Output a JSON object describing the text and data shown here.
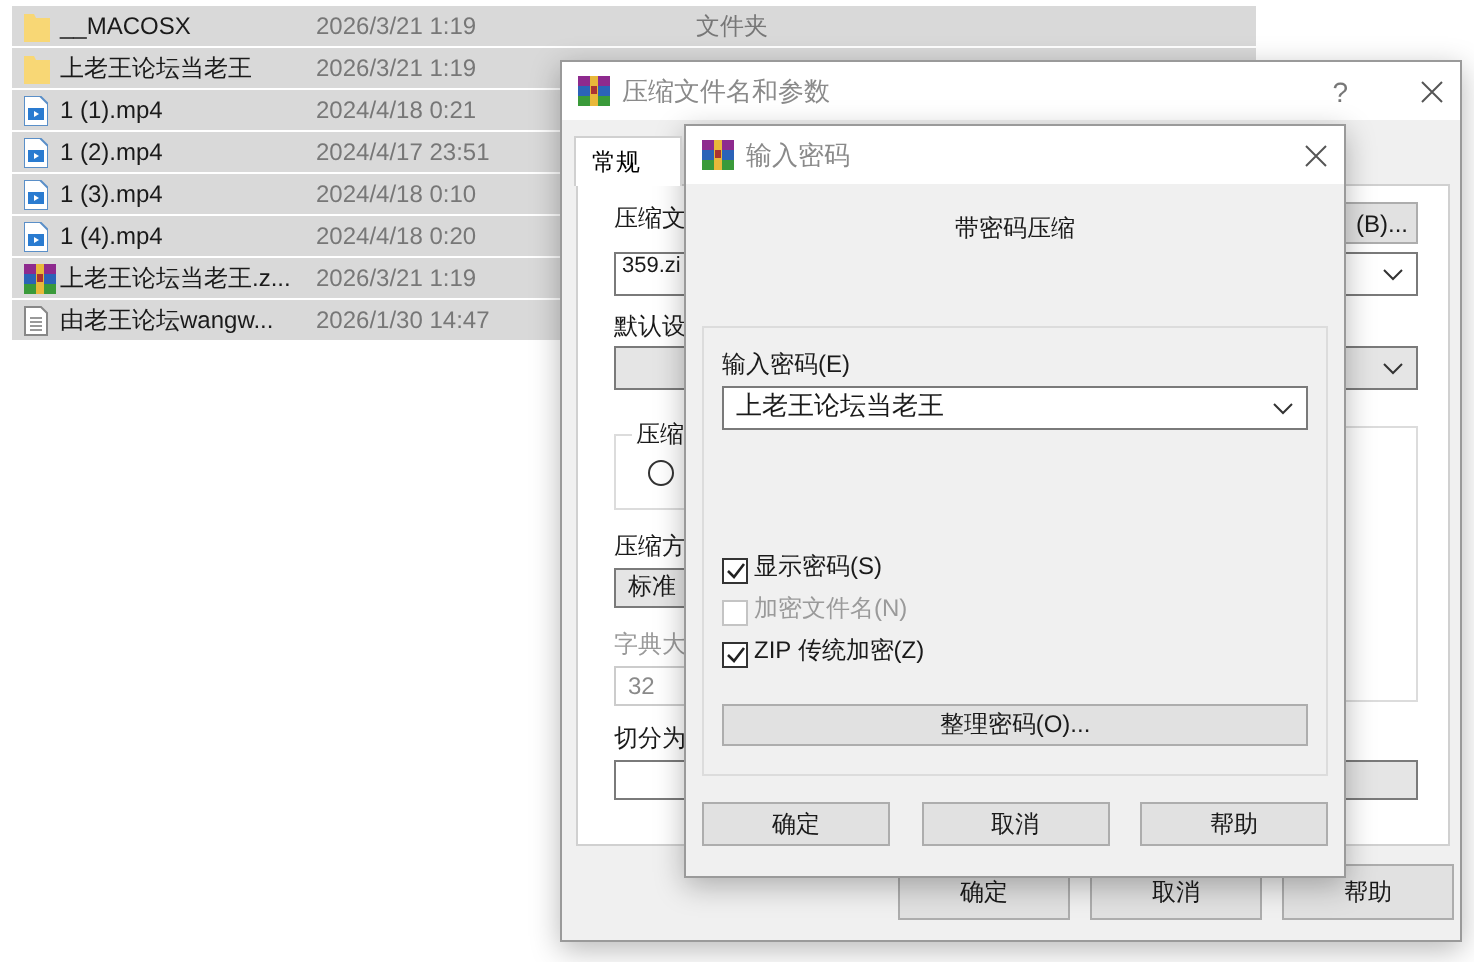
{
  "file_list": {
    "rows": [
      {
        "kind": "folder",
        "name": "__MACOSX",
        "date": "2026/3/21 1:19",
        "type": "文件夹",
        "selected": true
      },
      {
        "kind": "folder",
        "name": "上老王论坛当老王",
        "date": "2026/3/21 1:19",
        "selected": true
      },
      {
        "kind": "video",
        "name": "1 (1).mp4",
        "date": "2024/4/18 0:21",
        "selected": true
      },
      {
        "kind": "video",
        "name": "1 (2).mp4",
        "date": "2024/4/17 23:51",
        "selected": true
      },
      {
        "kind": "video",
        "name": "1 (3).mp4",
        "date": "2024/4/18 0:10",
        "selected": true
      },
      {
        "kind": "video",
        "name": "1 (4).mp4",
        "date": "2024/4/18 0:20",
        "selected": true
      },
      {
        "kind": "archive",
        "name": "上老王论坛当老王.z...",
        "date": "2026/3/21 1:19",
        "selected": true
      },
      {
        "kind": "text",
        "name": "由老王论坛wangw...",
        "date": "2026/1/30 14:47",
        "selected": true
      }
    ]
  },
  "archive_dialog": {
    "title": "压缩文件名和参数",
    "help": "?",
    "tabs": [
      {
        "label": "常规",
        "selected": true
      }
    ],
    "filename_label": "压缩文",
    "browse_button": "(B)...",
    "filename_value": "359.zi",
    "profile_label": "默认设",
    "format_group_label": "压缩",
    "format_option": {
      "selected": false
    },
    "method_label": "压缩方",
    "method_value": "标准",
    "dictionary_label": "字典大",
    "dictionary_value": "32",
    "split_label": "切分为",
    "buttons": [
      "确定",
      "取消",
      "帮助"
    ]
  },
  "password_dialog": {
    "title": "输入密码",
    "heading": "带密码压缩",
    "password_label": "输入密码(E)",
    "password_value": "上老王论坛当老王",
    "options": [
      {
        "label": "显示密码(S)",
        "checked": true,
        "disabled": false
      },
      {
        "label": "加密文件名(N)",
        "checked": false,
        "disabled": true
      },
      {
        "label": "ZIP 传统加密(Z)",
        "checked": true,
        "disabled": false
      }
    ],
    "organize_button": "整理密码(O)...",
    "buttons": [
      "确定",
      "取消",
      "帮助"
    ]
  }
}
